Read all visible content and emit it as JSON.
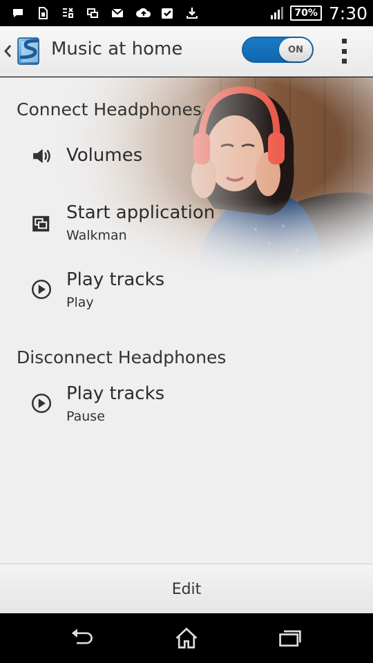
{
  "status_bar": {
    "battery": "70%",
    "time": "7:30",
    "icons": [
      "message-icon",
      "sim-icon",
      "data-transfer-icon",
      "screen-icon",
      "gmail-icon",
      "cloud-upload-icon",
      "checkbox-icon",
      "download-icon",
      "signal-icon",
      "battery-icon"
    ]
  },
  "action_bar": {
    "title": "Music at home",
    "toggle_label": "ON",
    "toggle_on": true,
    "accent": "#1a73bd"
  },
  "connect_section": {
    "title": "Connect Headphones",
    "items": [
      {
        "title": "Volumes",
        "subtitle": "",
        "icon": "speaker-icon"
      },
      {
        "title": "Start application",
        "subtitle": "Walkman",
        "icon": "app-window-icon"
      },
      {
        "title": "Play tracks",
        "subtitle": "Play",
        "icon": "play-circle-icon"
      }
    ]
  },
  "disconnect_section": {
    "title": "Disconnect Headphones",
    "items": [
      {
        "title": "Play tracks",
        "subtitle": "Pause",
        "icon": "play-circle-icon"
      }
    ]
  },
  "bottom_bar": {
    "edit_label": "Edit"
  },
  "nav_bar": {
    "icons": [
      "back-icon",
      "home-icon",
      "recents-icon"
    ]
  }
}
